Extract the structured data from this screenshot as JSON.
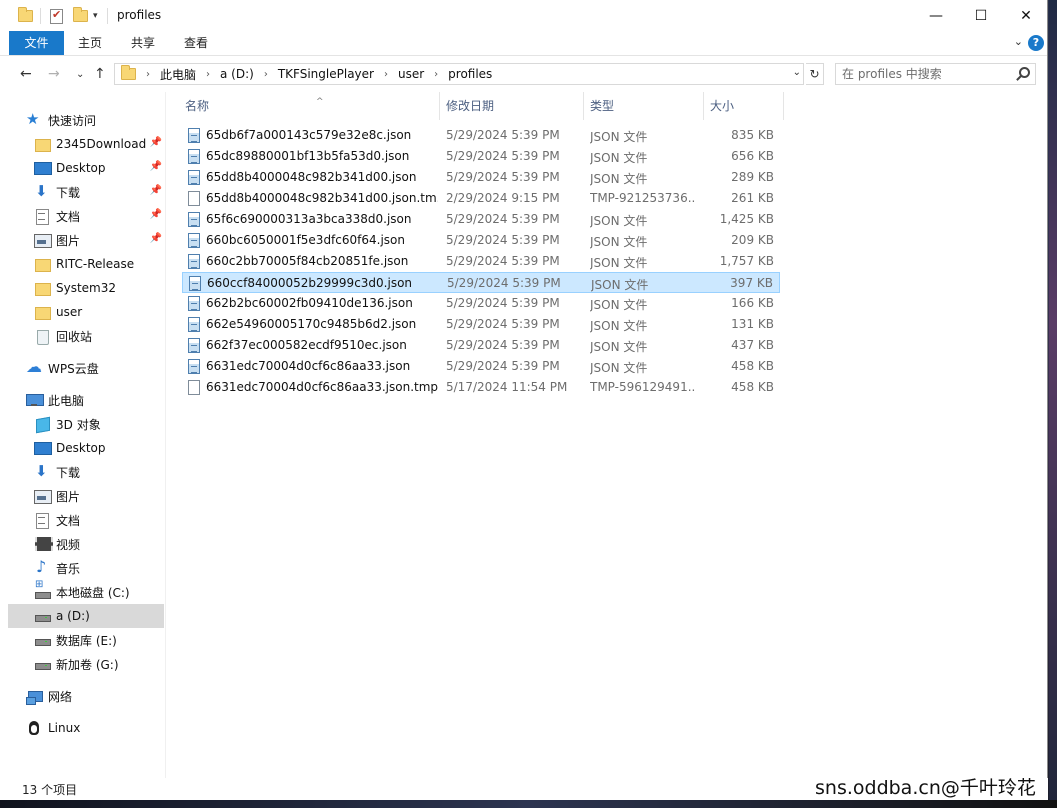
{
  "window": {
    "title": "profiles",
    "minimize_glyph": "—",
    "maximize_glyph": "☐",
    "close_glyph": "✕"
  },
  "ribbon": {
    "tabs": [
      {
        "label": "文件"
      },
      {
        "label": "主页"
      },
      {
        "label": "共享"
      },
      {
        "label": "查看"
      }
    ],
    "help_glyph": "?",
    "expand_glyph": "⌄"
  },
  "address": {
    "back_glyph": "←",
    "forward_glyph": "→",
    "recent_glyph": "⌄",
    "up_glyph": "↑",
    "crumbs": [
      "此电脑",
      "a (D:)",
      "TKFSinglePlayer",
      "user",
      "profiles"
    ],
    "separator": "›",
    "dropdown_glyph": "⌄",
    "refresh_glyph": "↻"
  },
  "search": {
    "placeholder": "在 profiles 中搜索"
  },
  "nav": {
    "quick_access": "快速访问",
    "pin_glyph": "📌",
    "items": [
      {
        "label": "快速访问",
        "icon": "star-icon"
      },
      {
        "label": "2345Download",
        "icon": "folder-icon",
        "pinned": true
      },
      {
        "label": "Desktop",
        "icon": "desktop-icon",
        "pinned": true
      },
      {
        "label": "下载",
        "icon": "download-icon",
        "pinned": true
      },
      {
        "label": "文档",
        "icon": "document-icon",
        "pinned": true
      },
      {
        "label": "图片",
        "icon": "picture-icon",
        "pinned": true
      },
      {
        "label": "RITC-Release",
        "icon": "folder-icon"
      },
      {
        "label": "System32",
        "icon": "folder-icon"
      },
      {
        "label": "user",
        "icon": "folder-icon"
      },
      {
        "label": "回收站",
        "icon": "recycle-bin-icon"
      },
      {
        "label": "WPS云盘",
        "icon": "cloud-icon"
      },
      {
        "label": "此电脑",
        "icon": "computer-icon"
      },
      {
        "label": "3D 对象",
        "icon": "3d-objects-icon"
      },
      {
        "label": "Desktop",
        "icon": "desktop-icon"
      },
      {
        "label": "下载",
        "icon": "download-icon"
      },
      {
        "label": "图片",
        "icon": "picture-icon"
      },
      {
        "label": "文档",
        "icon": "document-icon"
      },
      {
        "label": "视频",
        "icon": "video-icon"
      },
      {
        "label": "音乐",
        "icon": "music-icon"
      },
      {
        "label": "本地磁盘 (C:)",
        "icon": "system-drive-icon"
      },
      {
        "label": "a (D:)",
        "icon": "drive-icon",
        "selected": true
      },
      {
        "label": "数据库 (E:)",
        "icon": "drive-icon"
      },
      {
        "label": "新加卷 (G:)",
        "icon": "drive-icon"
      },
      {
        "label": "网络",
        "icon": "network-icon"
      },
      {
        "label": "Linux",
        "icon": "linux-icon"
      }
    ]
  },
  "columns": {
    "name": "名称",
    "date": "修改日期",
    "type": "类型",
    "size": "大小",
    "sort_glyph": "^"
  },
  "files": [
    {
      "name": "65db6f7a000143c579e32e8c.json",
      "date": "5/29/2024 5:39 PM",
      "type": "JSON 文件",
      "size": "835 KB",
      "kind": "json"
    },
    {
      "name": "65dc89880001bf13b5fa53d0.json",
      "date": "5/29/2024 5:39 PM",
      "type": "JSON 文件",
      "size": "656 KB",
      "kind": "json"
    },
    {
      "name": "65dd8b4000048c982b341d00.json",
      "date": "5/29/2024 5:39 PM",
      "type": "JSON 文件",
      "size": "289 KB",
      "kind": "json"
    },
    {
      "name": "65dd8b4000048c982b341d00.json.tm...",
      "date": "2/29/2024 9:15 PM",
      "type": "TMP-921253736...",
      "size": "261 KB",
      "kind": "tmp"
    },
    {
      "name": "65f6c690000313a3bca338d0.json",
      "date": "5/29/2024 5:39 PM",
      "type": "JSON 文件",
      "size": "1,425 KB",
      "kind": "json"
    },
    {
      "name": "660bc6050001f5e3dfc60f64.json",
      "date": "5/29/2024 5:39 PM",
      "type": "JSON 文件",
      "size": "209 KB",
      "kind": "json"
    },
    {
      "name": "660c2bb70005f84cb20851fe.json",
      "date": "5/29/2024 5:39 PM",
      "type": "JSON 文件",
      "size": "1,757 KB",
      "kind": "json"
    },
    {
      "name": "660ccf84000052b29999c3d0.json",
      "date": "5/29/2024 5:39 PM",
      "type": "JSON 文件",
      "size": "397 KB",
      "kind": "json",
      "selected": true
    },
    {
      "name": "662b2bc60002fb09410de136.json",
      "date": "5/29/2024 5:39 PM",
      "type": "JSON 文件",
      "size": "166 KB",
      "kind": "json"
    },
    {
      "name": "662e54960005170c9485b6d2.json",
      "date": "5/29/2024 5:39 PM",
      "type": "JSON 文件",
      "size": "131 KB",
      "kind": "json"
    },
    {
      "name": "662f37ec000582ecdf9510ec.json",
      "date": "5/29/2024 5:39 PM",
      "type": "JSON 文件",
      "size": "437 KB",
      "kind": "json"
    },
    {
      "name": "6631edc70004d0cf6c86aa33.json",
      "date": "5/29/2024 5:39 PM",
      "type": "JSON 文件",
      "size": "458 KB",
      "kind": "json"
    },
    {
      "name": "6631edc70004d0cf6c86aa33.json.tmp...",
      "date": "5/17/2024 11:54 PM",
      "type": "TMP-596129491...",
      "size": "458 KB",
      "kind": "tmp"
    }
  ],
  "status": {
    "item_count": "13 个项目"
  },
  "overlay": {
    "watermark": "sns.oddba.cn@千叶玲花"
  }
}
